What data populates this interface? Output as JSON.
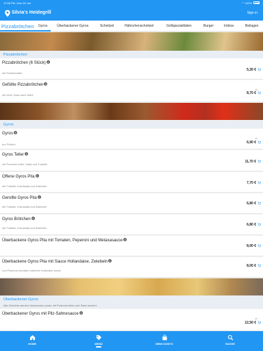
{
  "status": {
    "time": "12:58 PM",
    "date": "Mon 30 Jun",
    "battery": "100%"
  },
  "header": {
    "title": "Silvia's Heidegrill",
    "signin": "Sign in"
  },
  "tabs": [
    "Pizzabrötchen",
    "Gyros",
    "Überbackener Gyros",
    "Schnitzel",
    "Hähnchenschnitzel",
    "Grillspezialitäten",
    "Burger",
    "Imbiss",
    "Beilagen"
  ],
  "active_tab": "Pizzabrötchen",
  "categories": {
    "pizzabroetchen": "Pizzabrötchen",
    "gyros": "Gyros",
    "ueberbackener": {
      "title": "Überbackener Gyros",
      "note": "Alle Gerichte werden überbacken sowie mit Pommes frites und Salat serviert."
    }
  },
  "items": [
    {
      "name": "Pizzabrötchen (6 Stück)",
      "desc": "mit Kräuterbutter",
      "price": "5,30 €"
    },
    {
      "name": "Gefüllte Pizzabrötchen",
      "desc": "mit einer Zutat nach Wahl",
      "unit": "ab",
      "price": "8,70 €"
    },
    {
      "name": "Gyros",
      "desc": "nur Fleisch",
      "unit": "ab",
      "price": "6,90 €"
    },
    {
      "name": "Gyros Teller",
      "desc": "mit Pommes frites, Salat und Tzatziki",
      "price": "11,70 €"
    },
    {
      "name": "Offene Gyros Pita",
      "desc": "mit Tzatziki, Krautsalat und Zwiebeln",
      "price": "7,70 €"
    },
    {
      "name": "Gerollte Gyros Pita",
      "desc": "mit Tzatziki, Krautsalat und Zwiebeln",
      "price": "6,80 €"
    },
    {
      "name": "Gyros Brötchen",
      "desc": "mit Tzatziki, Krautsalat und Zwiebeln",
      "price": "6,80 €"
    },
    {
      "name": "Überbackene Gyros Pita mit Tomaten, Peperoni und Metaxasauce",
      "price": "8,00 €"
    },
    {
      "name": "Überbackene Gyros Pita mit Sauce Hollandaise, Zwiebeln",
      "desc": "und Peperoni tomaten zwiebeln hollandes sauce",
      "price": "8,00 €"
    },
    {
      "name": "Überbackener Gyros mit Pilz-Sahnesauce",
      "unit": "ab",
      "price": "12,50 €"
    }
  ],
  "bottom_nav": [
    "HOME",
    "MENÜ",
    "MEIN KONTO",
    "SUCHE"
  ],
  "colors": {
    "primary": "#2196f3",
    "category_bg": "#e8eef4"
  }
}
